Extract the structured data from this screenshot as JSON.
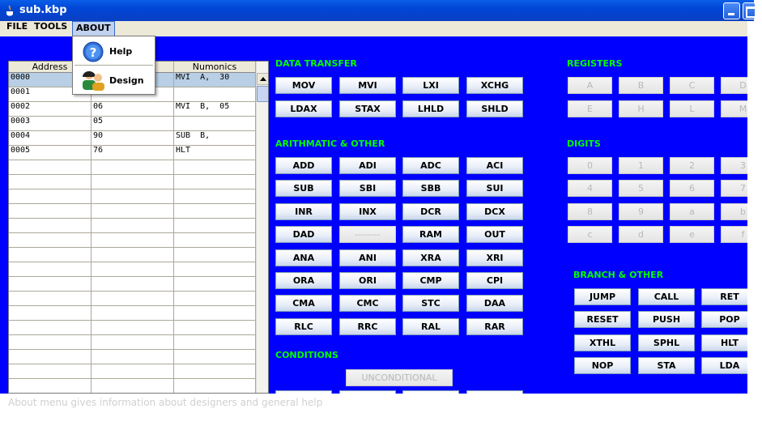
{
  "window": {
    "title": "sub.kbp"
  },
  "menubar": {
    "items": [
      "FILE",
      "TOOLS",
      "ABOUT"
    ]
  },
  "dropdown": {
    "items": [
      {
        "label": "Help",
        "icon": "help-question-icon"
      },
      {
        "label": "Design",
        "icon": "users-icon"
      }
    ]
  },
  "table": {
    "columns": [
      "Address",
      "",
      "Numonics"
    ],
    "rows": [
      [
        "0000",
        "",
        "MVI  A,  30"
      ],
      [
        "0001",
        "",
        ""
      ],
      [
        "0002",
        "06",
        "MVI  B,  05"
      ],
      [
        "0003",
        "05",
        ""
      ],
      [
        "0004",
        "90",
        "SUB  B,"
      ],
      [
        "0005",
        "76",
        "HLT"
      ]
    ]
  },
  "sections": {
    "data_transfer": "DATA TRANSFER",
    "arithmatic": "ARITHMATIC & OTHER",
    "conditions": "CONDITIONS",
    "registers": "REGISTERS",
    "digits": "DIGITS",
    "branch": "BRANCH & OTHER"
  },
  "data_transfer_buttons": [
    "MOV",
    "MVI",
    "LXI",
    "XCHG",
    "LDAX",
    "STAX",
    "LHLD",
    "SHLD"
  ],
  "arith_buttons": [
    "ADD",
    "ADI",
    "ADC",
    "ACI",
    "SUB",
    "SBI",
    "SBB",
    "SUI",
    "INR",
    "INX",
    "DCR",
    "DCX",
    "DAD",
    "--------",
    "RAM",
    "OUT",
    "ANA",
    "ANI",
    "XRA",
    "XRI",
    "ORA",
    "ORI",
    "CMP",
    "CPI",
    "CMA",
    "CMC",
    "STC",
    "DAA",
    "RLC",
    "RRC",
    "RAL",
    "RAR"
  ],
  "conditions_button": "UNCONDITIONAL",
  "register_buttons": [
    "A",
    "B",
    "C",
    "D",
    "E",
    "H",
    "L",
    "M"
  ],
  "digit_buttons": [
    "0",
    "1",
    "2",
    "3",
    "4",
    "5",
    "6",
    "7",
    "8",
    "9",
    "a",
    "b",
    "c",
    "d",
    "e",
    "f"
  ],
  "branch_buttons": [
    "JUMP",
    "CALL",
    "RET",
    "RESET",
    "PUSH",
    "POP",
    "XTHL",
    "SPHL",
    "HLT",
    "NOP",
    "STA",
    "LDA"
  ],
  "status": "About menu gives information about designers and general help"
}
